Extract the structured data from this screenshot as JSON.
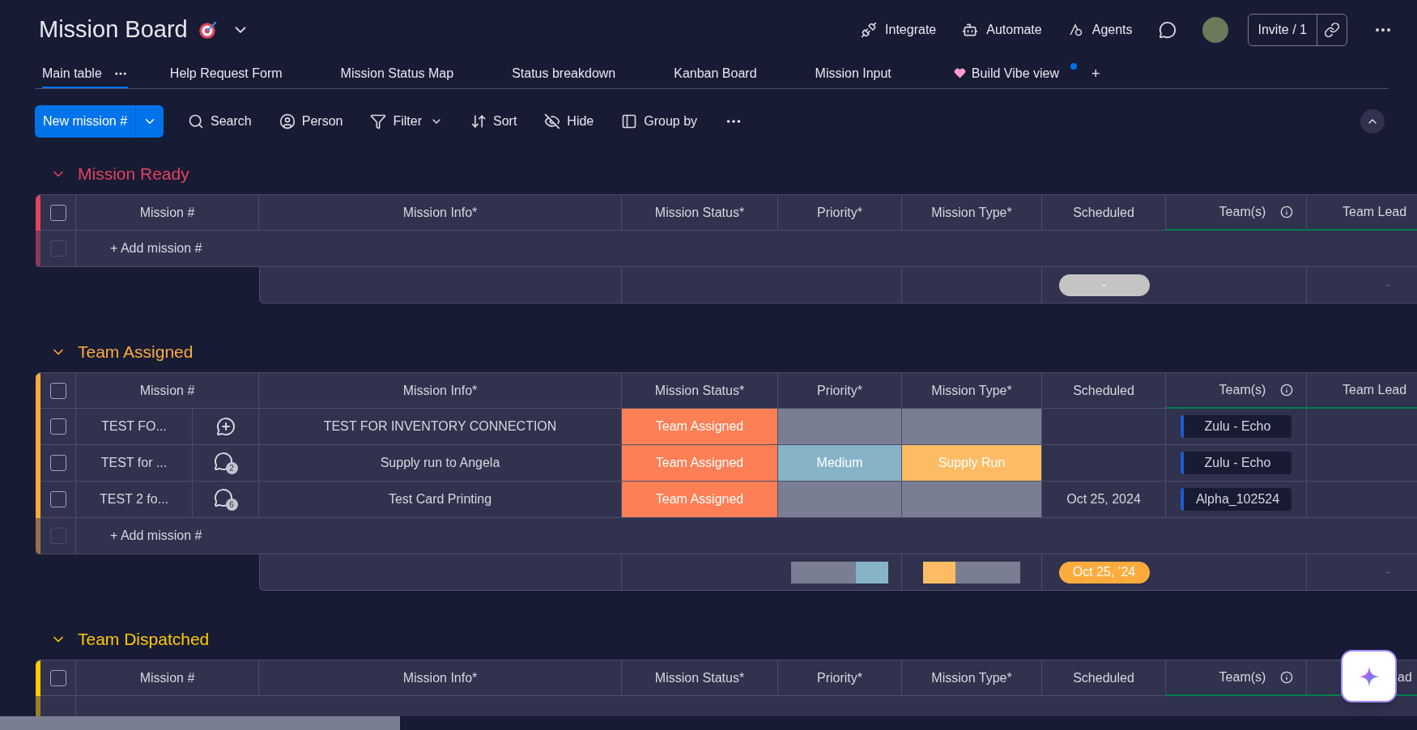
{
  "board": {
    "title": "Mission Board"
  },
  "top_actions": [
    {
      "kind": "integrate",
      "label": "Integrate"
    },
    {
      "kind": "automate",
      "label": "Automate"
    },
    {
      "kind": "agents",
      "label": "Agents"
    }
  ],
  "invite": {
    "label": "Invite / 1"
  },
  "tabs": [
    {
      "label": "Main table",
      "selected": true
    },
    {
      "label": "Help Request Form",
      "selected": false
    },
    {
      "label": "Mission Status Map",
      "selected": false
    },
    {
      "label": "Status breakdown",
      "selected": false
    },
    {
      "label": "Kanban Board",
      "selected": false
    },
    {
      "label": "Mission Input",
      "selected": false
    },
    {
      "label": "Build Vibe view",
      "selected": false,
      "kind": "vibe"
    }
  ],
  "add_view": "+",
  "toolbar": {
    "new_button": "New mission #",
    "items": [
      {
        "kind": "search",
        "label": "Search"
      },
      {
        "kind": "person",
        "label": "Person"
      },
      {
        "kind": "filter",
        "label": "Filter"
      },
      {
        "kind": "sort",
        "label": "Sort"
      },
      {
        "kind": "hide",
        "label": "Hide"
      },
      {
        "kind": "group",
        "label": "Group by"
      }
    ]
  },
  "groups": [
    {
      "title": "Mission Ready",
      "color": "#e2445c",
      "all_checked": false,
      "columns": [
        "Mission #",
        "Mission Info*",
        "Mission Status*",
        "Priority*",
        "Mission Type*",
        "Scheduled",
        "Team(s)",
        "Team Lead"
      ],
      "add_row": {
        "label": "+ Add mission #",
        "checked": false
      },
      "summary": {
        "scheduled": {
          "label": "-",
          "color": "#c4c4c4"
        },
        "team_lead": "-"
      }
    },
    {
      "title": "Team Assigned",
      "color": "#fdab3d",
      "all_checked": false,
      "columns": [
        "Mission #",
        "Mission Info*",
        "Mission Status*",
        "Priority*",
        "Mission Type*",
        "Scheduled",
        "Team(s)",
        "Team Lead"
      ],
      "rows": [
        {
          "checked": false,
          "mission": "TEST FO...",
          "comments": {
            "kind": "add"
          },
          "info": "TEST FOR INVENTORY CONNECTION",
          "status": {
            "label": "Team Assigned",
            "color": "#fd7f55"
          },
          "priority": {
            "color": "#797e93"
          },
          "type": {
            "color": "#797e93"
          },
          "team": "Zulu - Echo"
        },
        {
          "checked": false,
          "mission": "TEST for ...",
          "comments": {
            "kind": "count",
            "count": "2"
          },
          "info": "Supply run to Angela",
          "status": {
            "label": "Team Assigned",
            "color": "#fd7f55"
          },
          "priority": {
            "label": "Medium",
            "color": "#87b3c9"
          },
          "type": {
            "label": "Supply Run",
            "color": "#fdbc64"
          },
          "team": "Zulu - Echo"
        },
        {
          "checked": false,
          "mission": "TEST 2 fo...",
          "comments": {
            "kind": "count",
            "count": "6"
          },
          "info": "Test Card Printing",
          "status": {
            "label": "Team Assigned",
            "color": "#fd7f55"
          },
          "priority": {
            "color": "#797e93"
          },
          "type": {
            "color": "#797e93"
          },
          "scheduled": "Oct 25, 2024",
          "team": "Alpha_102524"
        }
      ],
      "add_row": {
        "label": "+ Add mission #",
        "checked": false
      },
      "summary": {
        "priority": [
          {
            "color": "#797e93",
            "level": 0.67
          },
          {
            "color": "#87b3c9",
            "level": 0.33
          }
        ],
        "type": [
          {
            "color": "#fdbc64",
            "level": 0.33
          },
          {
            "color": "#797e93",
            "level": 0.67
          }
        ],
        "scheduled": {
          "label": "Oct 25, ’24",
          "color": "#fdab3d"
        },
        "team_lead": "-"
      }
    },
    {
      "title": "Team Dispatched",
      "color": "#ffcb00",
      "all_checked": false,
      "columns": [
        "Mission #",
        "Mission Info*",
        "Mission Status*",
        "Priority*",
        "Mission Type*",
        "Scheduled",
        "Team(s)",
        "ad"
      ]
    }
  ]
}
